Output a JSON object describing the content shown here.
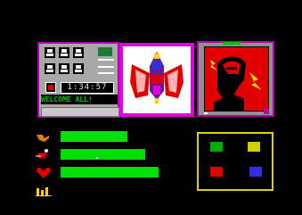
{
  "console": {
    "timer": "1:34:57",
    "message": "WELCOME ALL!"
  },
  "stats": {
    "stamina_level": 0.68,
    "speed_level": 0.86,
    "health_level": 1.0
  },
  "inventory": {
    "slots": [
      {
        "name": "green-item"
      },
      {
        "name": "yellow-item"
      },
      {
        "name": "red-item"
      },
      {
        "name": "blue-item"
      }
    ]
  },
  "colors": {
    "frame": "#b000b0",
    "bar": "#00e000",
    "inventory_border": "#e0d000",
    "screen": "#e00000"
  }
}
